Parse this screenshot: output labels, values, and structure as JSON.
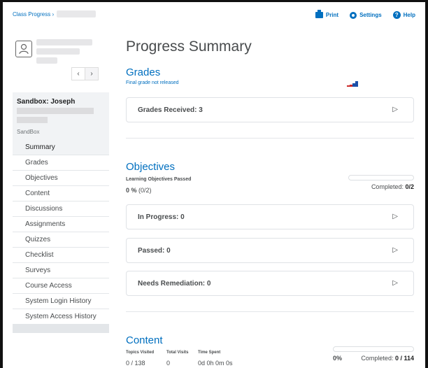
{
  "topbar": {
    "breadcrumb": "Class Progress ›",
    "actions": {
      "print": "Print",
      "settings": "Settings",
      "help": "Help"
    }
  },
  "sidebar": {
    "pager": {
      "prev": "‹",
      "next": "›"
    },
    "user": {
      "name": "Sandbox: Joseph",
      "org": "SandBox"
    },
    "items": [
      {
        "label": "Summary",
        "active": true
      },
      {
        "label": "Grades"
      },
      {
        "label": "Objectives"
      },
      {
        "label": "Content"
      },
      {
        "label": "Discussions"
      },
      {
        "label": "Assignments"
      },
      {
        "label": "Quizzes"
      },
      {
        "label": "Checklist"
      },
      {
        "label": "Surveys"
      },
      {
        "label": "Course Access"
      },
      {
        "label": "System Login History"
      },
      {
        "label": "System Access History"
      }
    ]
  },
  "main": {
    "title": "Progress Summary",
    "grades": {
      "heading": "Grades",
      "note": "Final grade not released",
      "received": "Grades Received: 3",
      "chart_colors": [
        "#cc2b2b",
        "#1b4fa8"
      ]
    },
    "objectives": {
      "heading": "Objectives",
      "passed_label": "Learning Objectives Passed",
      "pct": "0 %",
      "count": "(0/2)",
      "completed_label": "Completed:",
      "completed_value": "0/2",
      "completed_fraction": 0,
      "panels": [
        "In Progress: 0",
        "Passed: 0",
        "Needs Remediation: 0"
      ]
    },
    "content": {
      "heading": "Content",
      "labels": [
        "Topics Visited",
        "Total Visits",
        "Time Spent"
      ],
      "values": [
        "0 / 138",
        "0",
        "0d 0h 0m 0s"
      ],
      "pct": "0%",
      "completed_label": "Completed:",
      "completed_value": "0 / 114",
      "completed_fraction": 0
    }
  },
  "colors": {
    "accent": "#006fbf",
    "text": "#494c4e"
  }
}
